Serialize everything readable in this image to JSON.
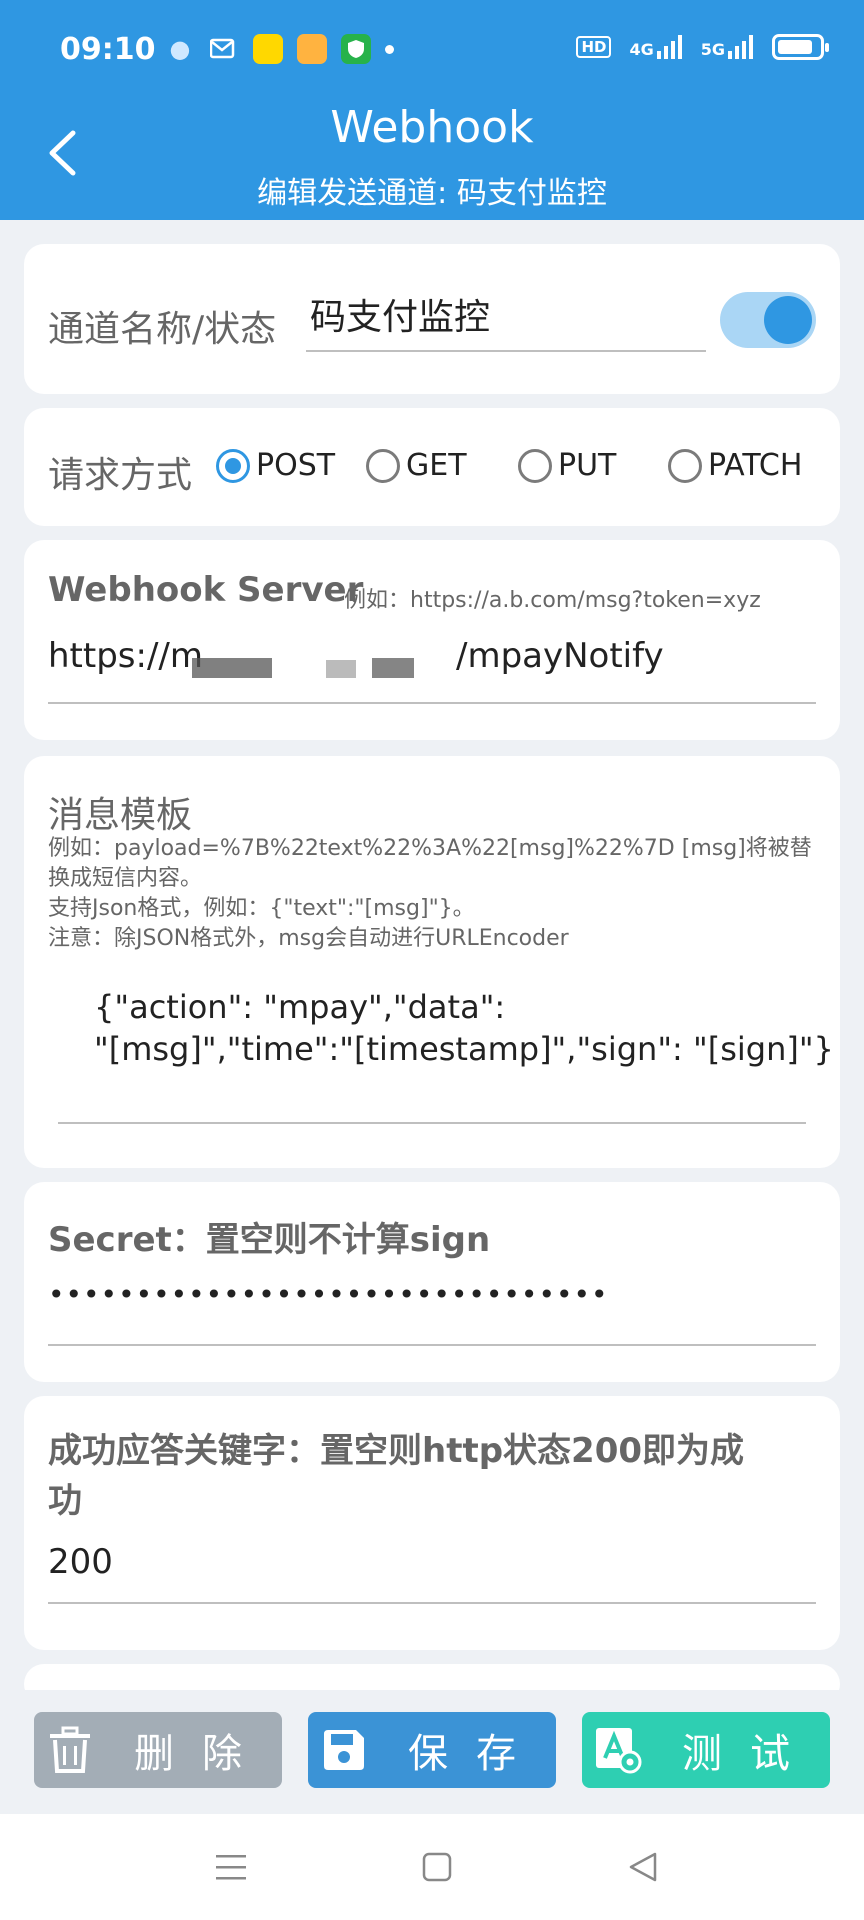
{
  "status_bar": {
    "time": "09:10",
    "hd_label": "HD",
    "net1": "4G",
    "net2": "5G"
  },
  "header": {
    "title": "Webhook",
    "subtitle": "编辑发送通道: 码支付监控"
  },
  "channel": {
    "label": "通道名称/状态",
    "name_value": "码支付监控",
    "enabled": true
  },
  "request": {
    "label": "请求方式",
    "options": [
      "POST",
      "GET",
      "PUT",
      "PATCH"
    ],
    "selected": "POST"
  },
  "server": {
    "label": "Webhook Server",
    "hint": "例如：https://a.b.com/msg?token=xyz",
    "value_prefix": "https://m",
    "value_suffix": "/mpayNotify"
  },
  "template": {
    "label": "消息模板",
    "hint_line1": "例如：payload=%7B%22text%22%3A%22[msg]%22%7D [msg]将被替",
    "hint_line2": "换成短信内容。",
    "hint_line3": "支持Json格式，例如：{\"text\":\"[msg]\"}。",
    "hint_line4": "注意：除JSON格式外，msg会自动进行URLEncoder",
    "value_line1": "{\"action\": \"mpay\",\"data\":",
    "value_line2": "\"[msg]\",\"time\":\"[timestamp]\",\"sign\": \"[sign]\"}"
  },
  "secret": {
    "label": "Secret：置空则不计算sign",
    "value": "••••••••••••••••••••••••••••••••"
  },
  "success": {
    "label_line1": "成功应答关键字：置空则http状态200即为成",
    "label_line2": "功",
    "value": "200"
  },
  "actions": {
    "delete_label": "删除",
    "save_label": "保存",
    "test_label": "测试"
  },
  "colors": {
    "primary": "#2f97e2",
    "delete": "#a3adb6",
    "save": "#3b93d6",
    "test": "#2ecfb2"
  }
}
